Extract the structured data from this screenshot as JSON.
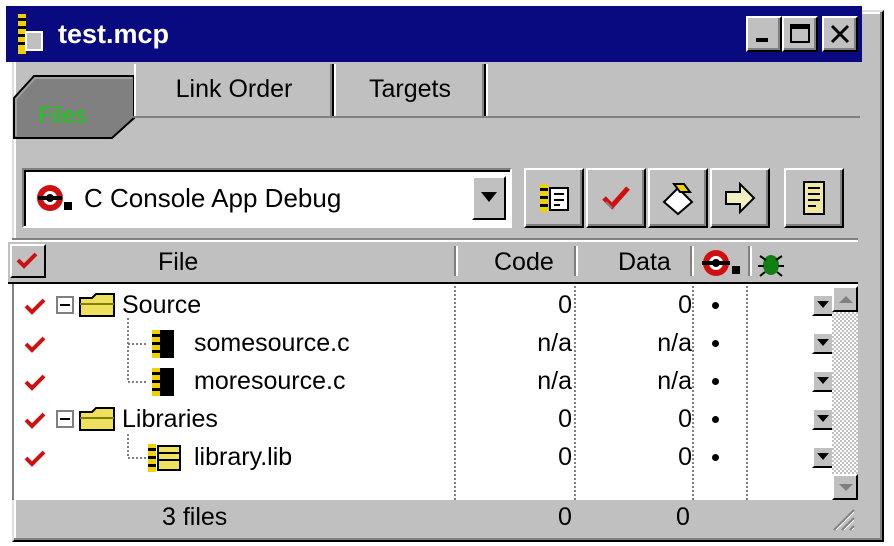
{
  "window": {
    "title": "test.mcp",
    "controls": [
      "minimize",
      "maximize",
      "close"
    ]
  },
  "tabs": [
    {
      "label": "Files",
      "active": true
    },
    {
      "label": "Link Order",
      "active": false
    },
    {
      "label": "Targets",
      "active": false
    }
  ],
  "target_select": {
    "value": "C Console App Debug"
  },
  "toolbar": {
    "icons": [
      "synchronize-icon",
      "checkmark-icon",
      "touch-icon",
      "run-icon",
      "project-inspector-icon"
    ]
  },
  "columns": {
    "file": "File",
    "code": "Code",
    "data": "Data"
  },
  "files": [
    {
      "name": "Source",
      "kind": "group",
      "code": "0",
      "data": "0"
    },
    {
      "name": "somesource.c",
      "kind": "file",
      "code": "n/a",
      "data": "n/a"
    },
    {
      "name": "moresource.c",
      "kind": "file",
      "code": "n/a",
      "data": "n/a"
    },
    {
      "name": "Libraries",
      "kind": "group",
      "code": "0",
      "data": "0"
    },
    {
      "name": "library.lib",
      "kind": "lib",
      "code": "0",
      "data": "0"
    }
  ],
  "status": {
    "count": "3 files",
    "code_total": "0",
    "data_total": "0"
  },
  "colors": {
    "titlebar": "#0a0a80",
    "active_tab_text": "#10d010",
    "check_red": "#d01010"
  }
}
